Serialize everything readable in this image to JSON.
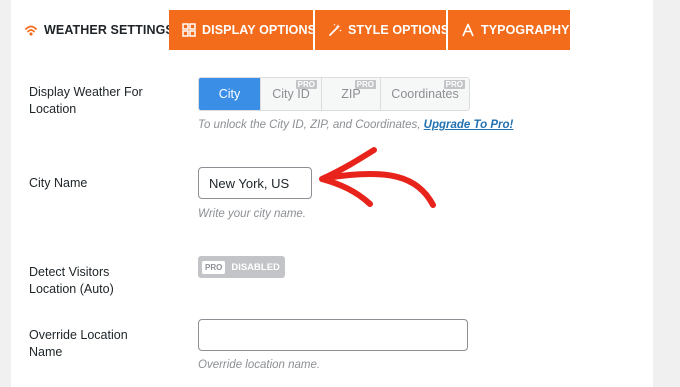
{
  "tabs": [
    {
      "label": "WEATHER SETTINGS",
      "icon": "weather-signal-icon"
    },
    {
      "label": "DISPLAY OPTIONS",
      "icon": "grid-icon"
    },
    {
      "label": "STYLE OPTIONS",
      "icon": "magic-wand-icon"
    },
    {
      "label": "TYPOGRAPHY",
      "icon": "letter-a-icon"
    }
  ],
  "location": {
    "label": "Display Weather For Location",
    "options": [
      {
        "label": "City",
        "pro": "",
        "selected": true
      },
      {
        "label": "City ID",
        "pro": "PRO",
        "selected": false
      },
      {
        "label": "ZIP",
        "pro": "PRO",
        "selected": false
      },
      {
        "label": "Coordinates",
        "pro": "PRO",
        "selected": false
      }
    ],
    "hint": "To unlock the City ID, ZIP, and Coordinates,",
    "upgrade_link": "Upgrade To Pro!"
  },
  "city": {
    "label": "City Name",
    "value": "New York, US",
    "hint": "Write your city name."
  },
  "detect": {
    "label": "Detect Visitors Location (Auto)",
    "pro_badge": "PRO",
    "status": "DISABLED"
  },
  "override": {
    "label": "Override Location Name",
    "value": "",
    "hint": "Override location name."
  },
  "colors": {
    "accent": "#f26c1b",
    "selected": "#3a8ee6",
    "arrow": "#e8231b"
  }
}
